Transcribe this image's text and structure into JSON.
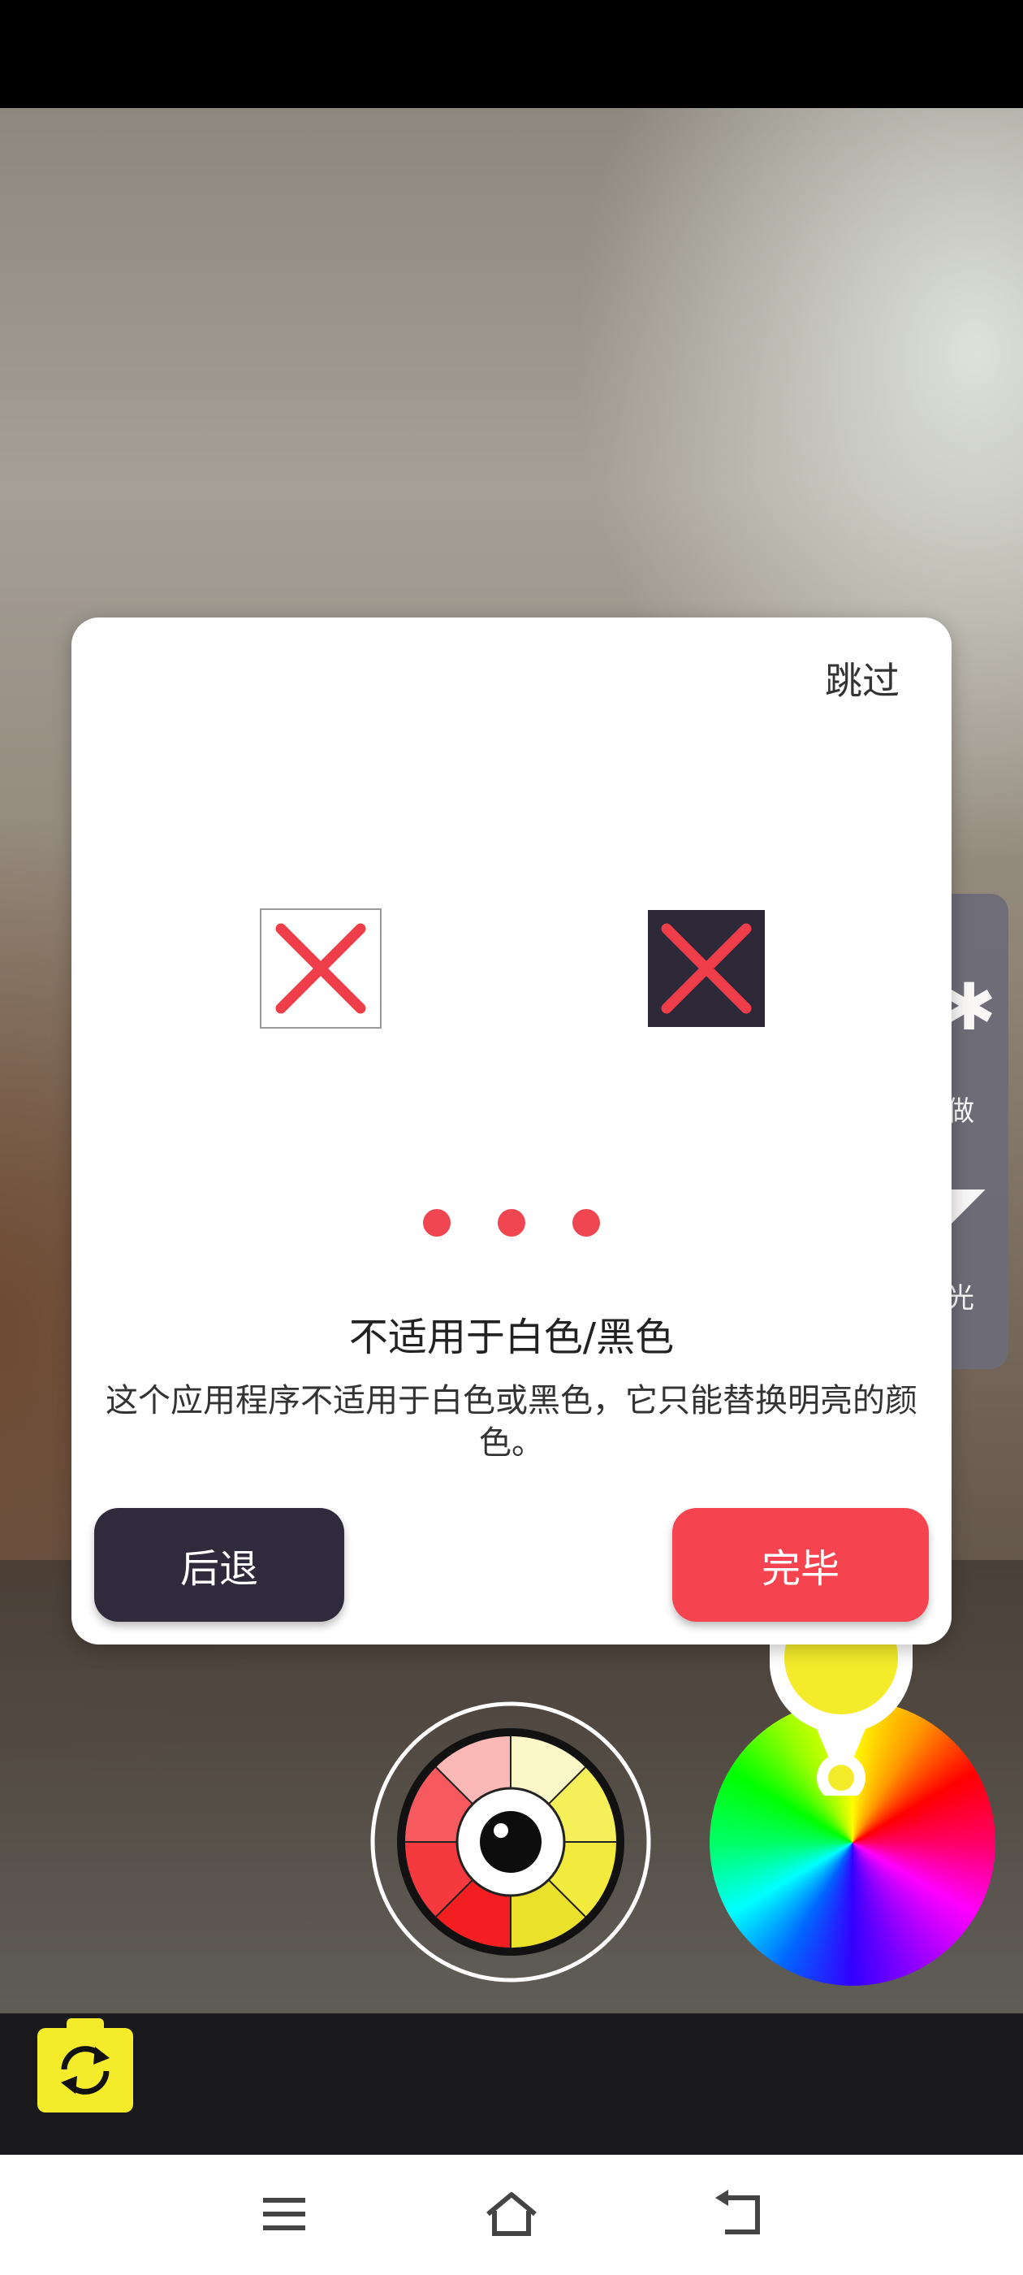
{
  "dialog": {
    "skip_label": "跳过",
    "title": "不适用于白色/黑色",
    "description": "这个应用程序不适用于白色或黑色，它只能替换明亮的颜色。",
    "back_label": "后退",
    "done_label": "完毕",
    "page_count": 3
  },
  "side_panel": {
    "item1_label": "做",
    "item2_label": "光"
  },
  "icons": {
    "white_sample": "close-icon",
    "black_sample": "close-icon",
    "flip_camera": "camera-flip-icon",
    "nav_menu": "menu-icon",
    "nav_home": "home-icon",
    "nav_back": "back-icon"
  },
  "colors": {
    "accent": "#f5444f",
    "back_button": "#2f2a3c",
    "picker_color": "#f4ec2a",
    "flip_camera_bg": "#f4ec2a"
  }
}
